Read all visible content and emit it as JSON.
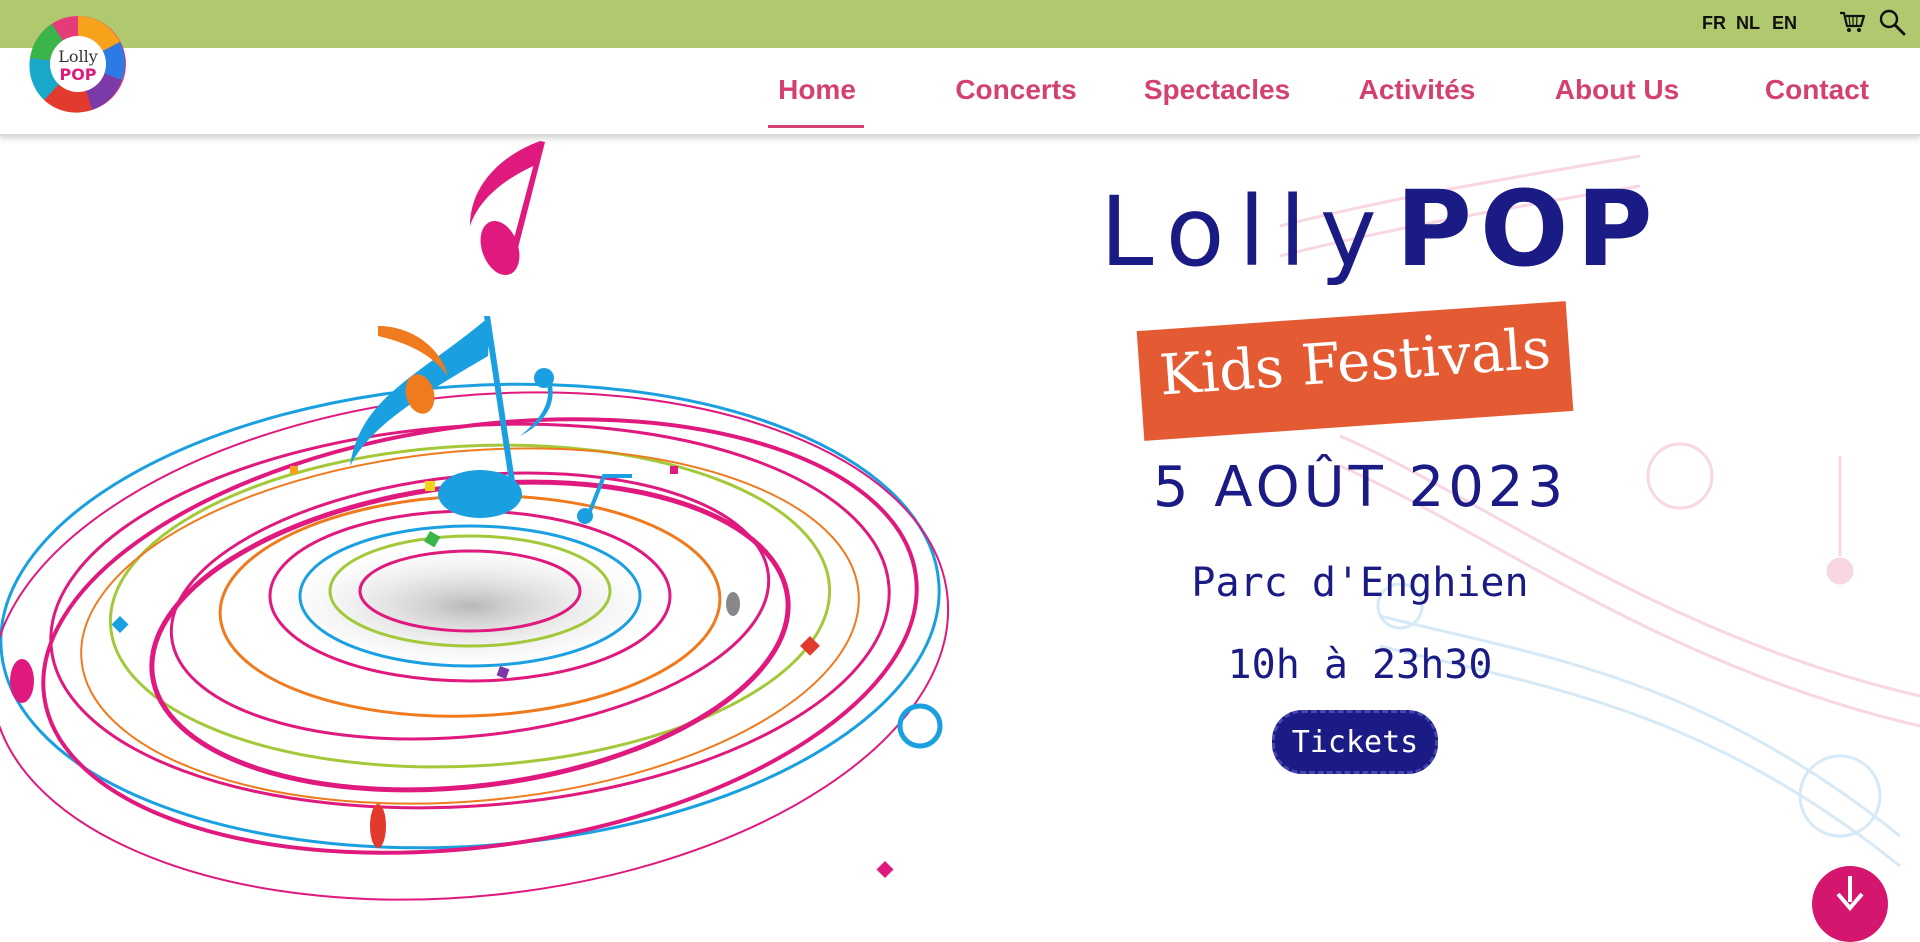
{
  "topbar": {
    "languages": [
      "FR",
      "NL",
      "EN"
    ],
    "cart_icon": "cart-icon",
    "search_icon": "search-icon"
  },
  "logo": {
    "line1": "Lolly",
    "line2": "POP"
  },
  "nav": {
    "items": [
      "Home",
      "Concerts",
      "Spectacles",
      "Activités",
      "About Us",
      "Contact"
    ],
    "active": "Home"
  },
  "hero": {
    "title_lolly": "Lolly",
    "title_pop": "POP",
    "banner": "Kids Festivals",
    "date": "5 AOÛT 2023",
    "place": "Parc d'Enghien",
    "hours": "10h à 23h30",
    "tickets": "Tickets"
  },
  "colors": {
    "topbar": "#b0c96f",
    "nav_text": "#d4416e",
    "navy": "#1b1b86",
    "banner": "#e45a33",
    "scroll_button": "#d4166f"
  },
  "icons": {
    "scroll": "arrow-down-icon"
  }
}
